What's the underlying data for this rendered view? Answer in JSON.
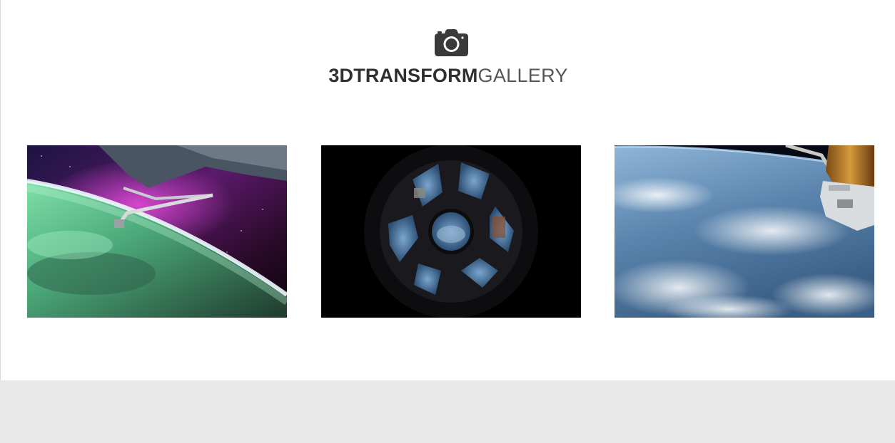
{
  "header": {
    "icon": "camera-icon",
    "title_bold": "3DTRANSFORM",
    "title_light": "GALLERY"
  },
  "gallery": {
    "items": [
      {
        "subject": "aurora-over-earth-with-station-arm"
      },
      {
        "subject": "cupola-window-view"
      },
      {
        "subject": "earth-clouds-with-spacecraft"
      }
    ]
  },
  "colors": {
    "page_background": "#ffffff",
    "footer_background": "#e9e9e9",
    "title_text": "#2f2f2f",
    "icon": "#3a3a3a"
  }
}
